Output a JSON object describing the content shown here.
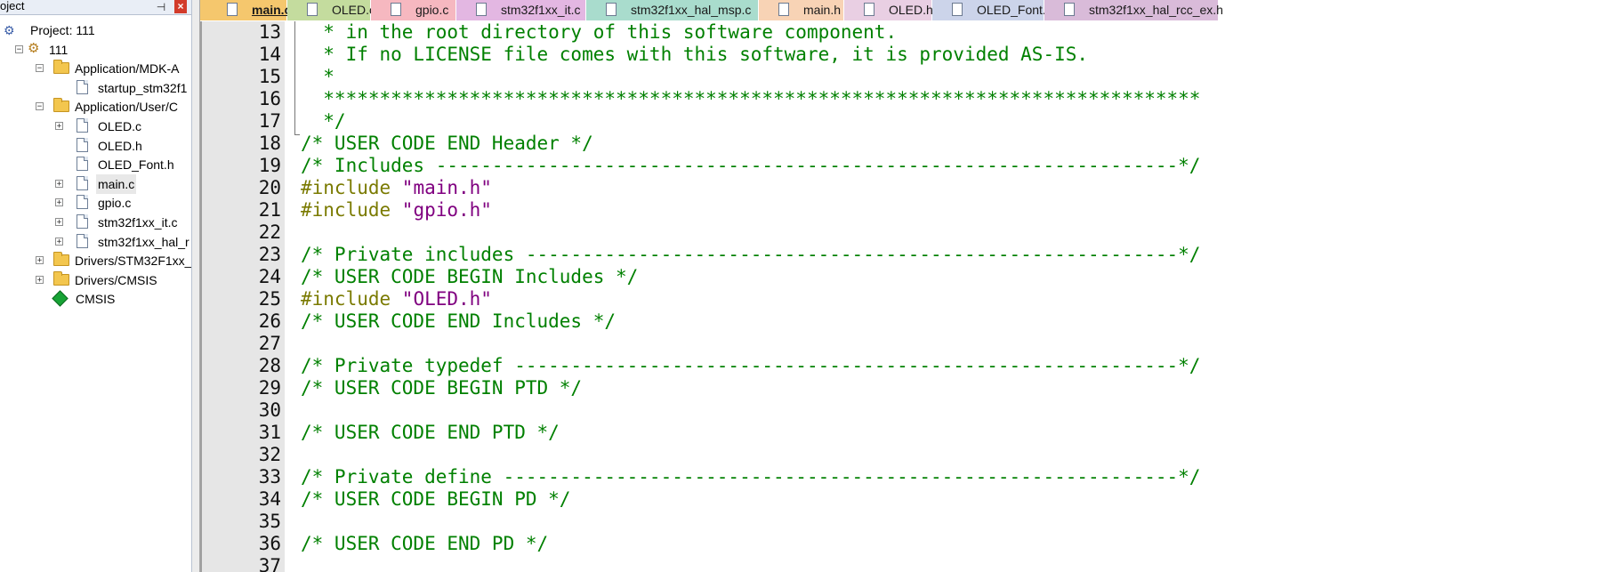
{
  "project_panel": {
    "title": "oject",
    "pin_glyph": "⊣",
    "close_glyph": "×",
    "tree": [
      {
        "label": "Project: 111",
        "kind": "project",
        "depth": 0,
        "expander": ""
      },
      {
        "label": "111",
        "kind": "target",
        "depth": 1,
        "expander": "−"
      },
      {
        "label": "Application/MDK-A",
        "kind": "folder",
        "depth": 2,
        "expander": "−"
      },
      {
        "label": "startup_stm32f1",
        "kind": "file",
        "depth": 3,
        "expander": ""
      },
      {
        "label": "Application/User/C",
        "kind": "folder",
        "depth": 2,
        "expander": "−"
      },
      {
        "label": "OLED.c",
        "kind": "file",
        "depth": 3,
        "expander": "+"
      },
      {
        "label": "OLED.h",
        "kind": "file",
        "depth": 3,
        "expander": ""
      },
      {
        "label": "OLED_Font.h",
        "kind": "file",
        "depth": 3,
        "expander": ""
      },
      {
        "label": "main.c",
        "kind": "file",
        "depth": 3,
        "expander": "+",
        "selected": true
      },
      {
        "label": "gpio.c",
        "kind": "file",
        "depth": 3,
        "expander": "+"
      },
      {
        "label": "stm32f1xx_it.c",
        "kind": "file",
        "depth": 3,
        "expander": "+"
      },
      {
        "label": "stm32f1xx_hal_r",
        "kind": "file",
        "depth": 3,
        "expander": "+"
      },
      {
        "label": "Drivers/STM32F1xx_",
        "kind": "folder",
        "depth": 2,
        "expander": "+"
      },
      {
        "label": "Drivers/CMSIS",
        "kind": "folder",
        "depth": 2,
        "expander": "+"
      },
      {
        "label": "CMSIS",
        "kind": "cmsis",
        "depth": 2,
        "expander": ""
      }
    ]
  },
  "tabs": [
    {
      "label": "main.c",
      "color": "#f5c76d",
      "active": true
    },
    {
      "label": "OLED.c*",
      "color": "#c4dc9e"
    },
    {
      "label": "gpio.c",
      "color": "#f6b8c0"
    },
    {
      "label": "stm32f1xx_it.c",
      "color": "#e3b7e2"
    },
    {
      "label": "stm32f1xx_hal_msp.c",
      "color": "#a9dccd"
    },
    {
      "label": "main.h",
      "color": "#f8d3b5"
    },
    {
      "label": "OLED.h",
      "color": "#e9cfe3"
    },
    {
      "label": "OLED_Font.h",
      "color": "#ccd4ea"
    },
    {
      "label": "stm32f1xx_hal_rcc_ex.h",
      "color": "#d9bbd9"
    }
  ],
  "code": [
    {
      "num": "13",
      "text": "  * in the root directory of this software component."
    },
    {
      "num": "14",
      "text": "  * If no LICENSE file comes with this software, it is provided AS-IS."
    },
    {
      "num": "15",
      "text": "  *"
    },
    {
      "num": "16",
      "text": "  ******************************************************************************"
    },
    {
      "num": "17",
      "text": "  */"
    },
    {
      "num": "18",
      "text": "/* USER CODE END Header */"
    },
    {
      "num": "19",
      "text": "/* Includes ------------------------------------------------------------------*/"
    },
    {
      "num": "20",
      "pre": "#include ",
      "str": "\"main.h\""
    },
    {
      "num": "21",
      "pre": "#include ",
      "str": "\"gpio.h\""
    },
    {
      "num": "22",
      "text": ""
    },
    {
      "num": "23",
      "text": "/* Private includes ----------------------------------------------------------*/"
    },
    {
      "num": "24",
      "text": "/* USER CODE BEGIN Includes */"
    },
    {
      "num": "25",
      "pre": "#include ",
      "str": "\"OLED.h\""
    },
    {
      "num": "26",
      "text": "/* USER CODE END Includes */"
    },
    {
      "num": "27",
      "text": ""
    },
    {
      "num": "28",
      "text": "/* Private typedef -----------------------------------------------------------*/"
    },
    {
      "num": "29",
      "text": "/* USER CODE BEGIN PTD */"
    },
    {
      "num": "30",
      "text": ""
    },
    {
      "num": "31",
      "text": "/* USER CODE END PTD */"
    },
    {
      "num": "32",
      "text": ""
    },
    {
      "num": "33",
      "text": "/* Private define ------------------------------------------------------------*/"
    },
    {
      "num": "34",
      "text": "/* USER CODE BEGIN PD */"
    },
    {
      "num": "35",
      "text": ""
    },
    {
      "num": "36",
      "text": "/* USER CODE END PD */"
    },
    {
      "num": "37",
      "text": ""
    }
  ]
}
